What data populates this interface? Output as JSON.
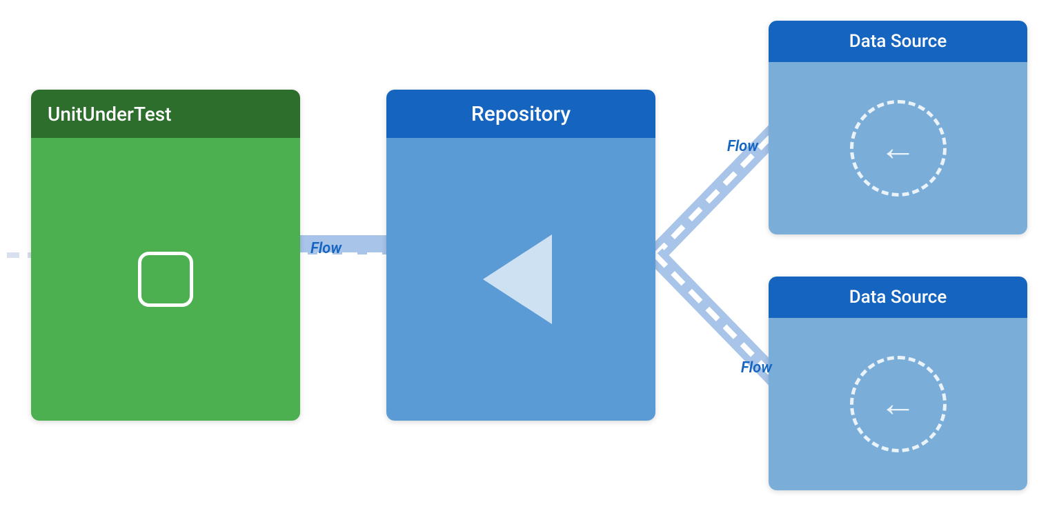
{
  "diagram": {
    "background": "#ffffff",
    "unit_under_test": {
      "header_label": "UnitUnderTest",
      "header_bg": "#2d6e2d",
      "body_bg": "#4caf50"
    },
    "repository": {
      "header_label": "Repository",
      "header_bg": "#1565c0",
      "body_bg": "#5b9bd5"
    },
    "data_source_top": {
      "header_label": "Data Source",
      "header_bg": "#1565c0",
      "body_bg": "#7badd9"
    },
    "data_source_bottom": {
      "header_label": "Data Source",
      "header_bg": "#1565c0",
      "body_bg": "#7badd9"
    },
    "flow_labels": {
      "main": "Flow",
      "top": "Flow",
      "bottom": "Flow"
    }
  }
}
